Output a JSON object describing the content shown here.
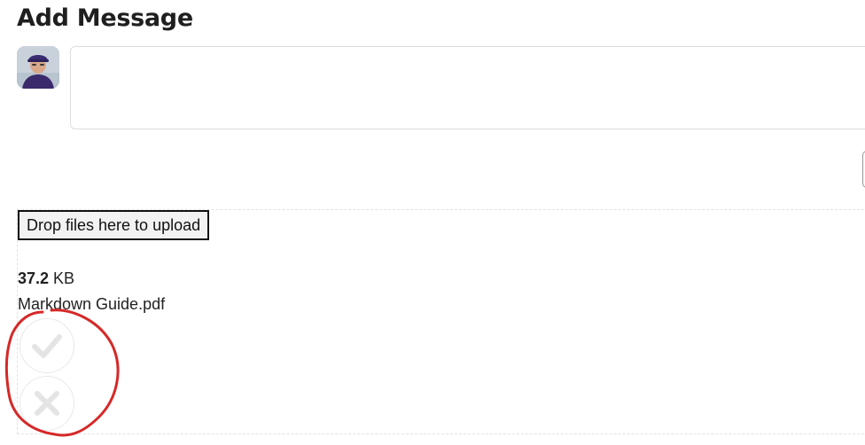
{
  "page": {
    "title": "Add Message"
  },
  "composer": {
    "avatar_alt": "user avatar",
    "message_value": "",
    "message_placeholder": ""
  },
  "dropzone": {
    "button_label": "Drop files here to upload"
  },
  "file": {
    "size_value": "37.2",
    "size_unit": " KB",
    "name": "Markdown Guide.pdf",
    "success_icon": "checkmark-icon",
    "error_icon": "x-mark-icon"
  },
  "colors": {
    "annotation": "#d62828",
    "border": "#dcdcdc",
    "icon_outline": "#e6e6e6"
  }
}
